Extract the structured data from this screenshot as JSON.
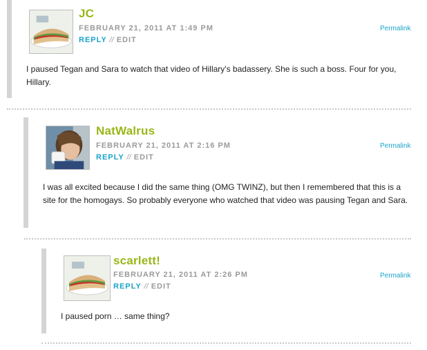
{
  "comments": [
    {
      "author": "JC",
      "date": "FEBRUARY 21, 2011 AT 1:49 PM",
      "reply": "REPLY",
      "separator": "//",
      "edit": "EDIT",
      "permalink": "Permalink",
      "avatar_icon": "sandwich-avatar-icon",
      "text": "I paused Tegan and Sara to watch that video of Hillary's badassery. She is such a boss. Four for you, Hillary."
    },
    {
      "author": "NatWalrus",
      "date": "FEBRUARY 21, 2011 AT 2:16 PM",
      "reply": "REPLY",
      "separator": "//",
      "edit": "EDIT",
      "permalink": "Permalink",
      "avatar_icon": "person-drinking-avatar-icon",
      "text": "I was all excited because I did the same thing (OMG TWINZ), but then I remembered that this is a site for the homogays. So probably everyone who watched that video was pausing Tegan and Sara."
    },
    {
      "author": "scarlett!",
      "date": "FEBRUARY 21, 2011 AT 2:26 PM",
      "reply": "REPLY",
      "separator": "//",
      "edit": "EDIT",
      "permalink": "Permalink",
      "avatar_icon": "sandwich-avatar-icon",
      "text": "I paused porn … same thing?"
    }
  ],
  "colors": {
    "author": "#99b618",
    "link": "#1aa4c9",
    "meta": "#9a9a9a",
    "bar": "#d4d4d4"
  }
}
